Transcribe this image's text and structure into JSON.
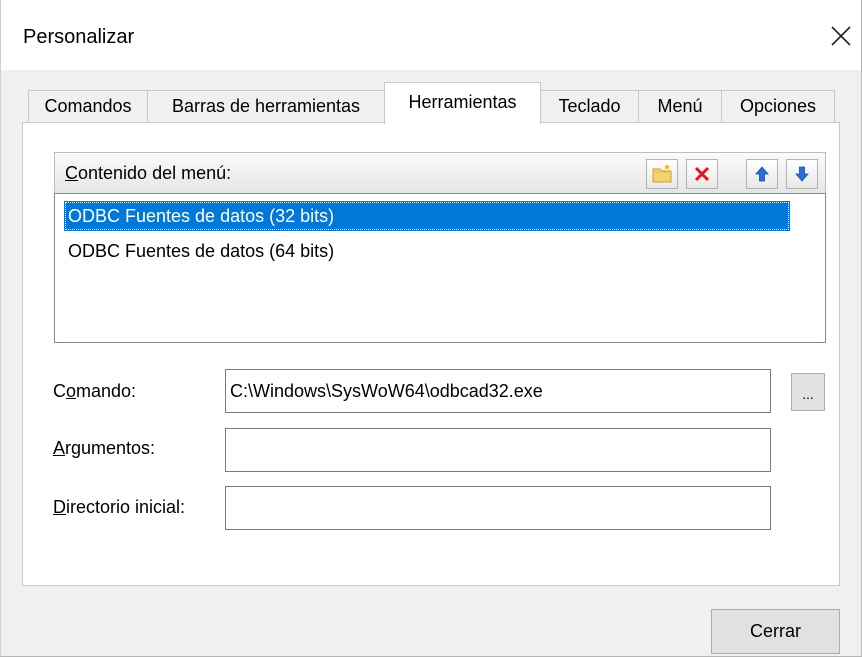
{
  "window": {
    "title": "Personalizar"
  },
  "tabs": [
    {
      "label": "Comandos",
      "active": false
    },
    {
      "label": "Barras de herramientas",
      "active": false
    },
    {
      "label": "Herramientas",
      "active": true
    },
    {
      "label": "Teclado",
      "active": false
    },
    {
      "label": "Menú",
      "active": false
    },
    {
      "label": "Opciones",
      "active": false
    }
  ],
  "menu_contents": {
    "label_accel": "C",
    "label_rest": "ontenido del menú:",
    "toolbar_icons": [
      "new-folder-icon",
      "delete-icon",
      "move-up-icon",
      "move-down-icon"
    ],
    "items": [
      {
        "label": "ODBC Fuentes de datos (32 bits)",
        "selected": true
      },
      {
        "label": "ODBC Fuentes de datos (64 bits)",
        "selected": false
      }
    ]
  },
  "fields": {
    "command": {
      "label_pre": "C",
      "label_accel": "o",
      "label_rest": "mando:",
      "value": "C:\\Windows\\SysWoW64\\odbcad32.exe"
    },
    "arguments": {
      "label_accel": "A",
      "label_rest": "rgumentos:",
      "value": ""
    },
    "initial_dir": {
      "label_accel": "D",
      "label_rest": "irectorio inicial:",
      "value": ""
    }
  },
  "browse_button_label": "...",
  "close_button_label": "Cerrar",
  "colors": {
    "selection": "#0078d7",
    "delete_red": "#e81123",
    "arrow_blue": "#2a6fd6",
    "folder_yellow": "#f5d36b"
  }
}
